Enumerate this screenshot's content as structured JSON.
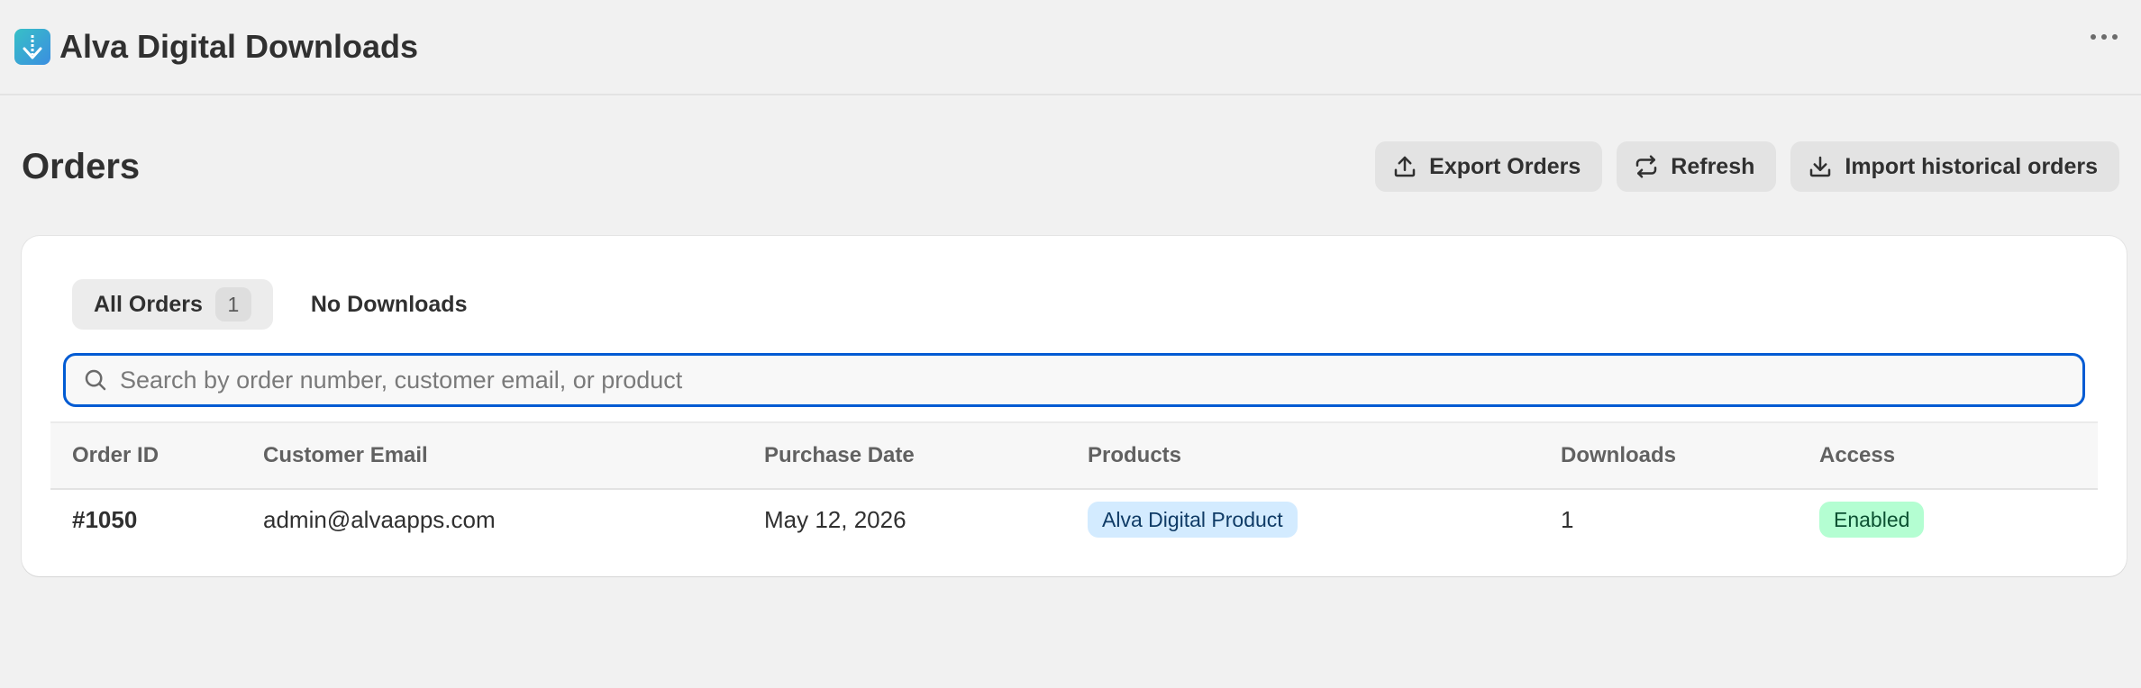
{
  "app": {
    "title": "Alva Digital Downloads",
    "logo_icon": "download-arrow-icon",
    "brand_colors": [
      "#37c0c7",
      "#3b8ee0"
    ]
  },
  "page": {
    "title": "Orders",
    "actions": {
      "export_label": "Export Orders",
      "refresh_label": "Refresh",
      "import_label": "Import historical orders"
    }
  },
  "tabs": [
    {
      "label": "All Orders",
      "count": "1",
      "active": true
    },
    {
      "label": "No Downloads",
      "active": false
    }
  ],
  "search": {
    "value": "",
    "placeholder": "Search by order number, customer email, or product",
    "focus_color": "#005bd3"
  },
  "table": {
    "columns": [
      "Order ID",
      "Customer Email",
      "Purchase Date",
      "Products",
      "Downloads",
      "Access"
    ],
    "rows": [
      {
        "order_id": "#1050",
        "email": "admin@alvaapps.com",
        "date": "May 12, 2026",
        "product": "Alva Digital Product",
        "downloads": "1",
        "access": "Enabled"
      }
    ]
  },
  "colors": {
    "product_badge": "#d3ebff",
    "enabled_badge": "#b4fed2"
  }
}
